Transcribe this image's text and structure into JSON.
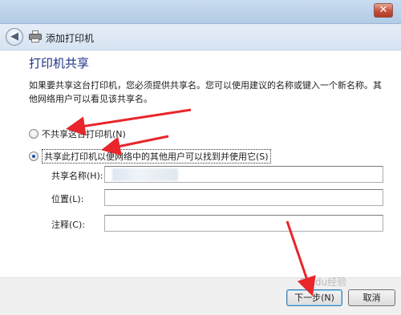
{
  "window": {
    "close_glyph": "✕"
  },
  "nav": {
    "back_glyph": "◀",
    "title": "添加打印机"
  },
  "page": {
    "heading": "打印机共享",
    "description": "如果要共享这台打印机，您必须提供共享名。您可以使用建议的名称或键入一个新名称。其他网络用户可以看见该共享名。"
  },
  "options": {
    "no_share_label": "不共享这台打印机(N)",
    "share_label": "共享此打印机以便网络中的其他用户可以找到并使用它(S)",
    "selected": "share"
  },
  "fields": {
    "share_name": {
      "label": "共享名称(H):",
      "value": ""
    },
    "location": {
      "label": "位置(L):",
      "value": ""
    },
    "comment": {
      "label": "注释(C):",
      "value": ""
    }
  },
  "buttons": {
    "next": "下一步(N)",
    "cancel": "取消"
  },
  "watermark": "Baidu经验",
  "colors": {
    "heading": "#1e3287",
    "annotation_arrow": "#e8262b",
    "close_button": "#c4503a"
  },
  "icons": [
    "back-arrow-icon",
    "printer-icon",
    "close-icon"
  ]
}
